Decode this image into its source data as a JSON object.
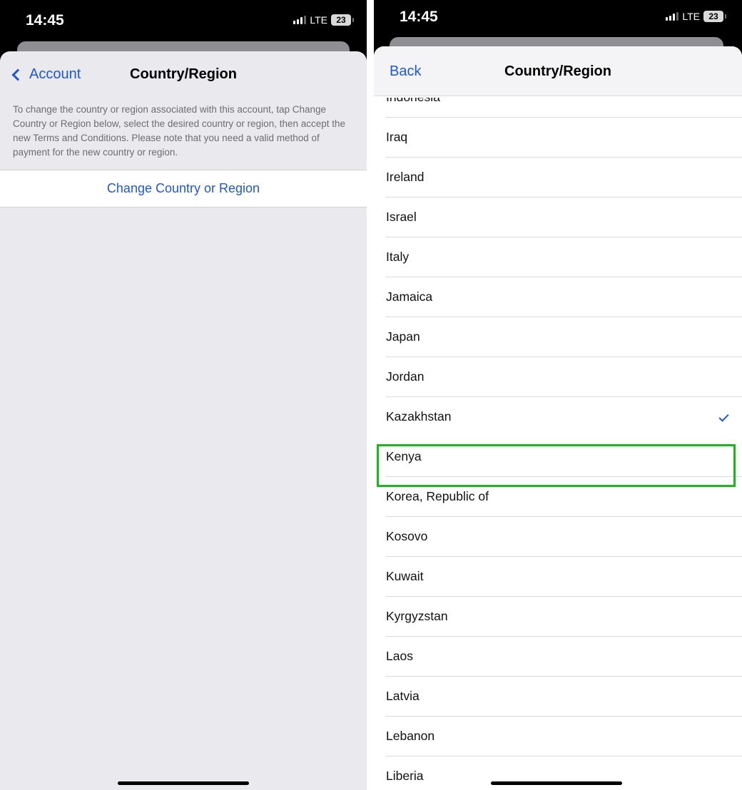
{
  "left": {
    "status": {
      "time": "14:45",
      "network": "LTE",
      "battery": "23"
    },
    "nav": {
      "back_label": "Account",
      "title": "Country/Region"
    },
    "explainer": "To change the country or region associated with this account, tap Change Country or Region below, select the desired country or region, then accept the new Terms and Conditions. Please note that you need a valid method of payment for the new country or region.",
    "change_button": "Change Country or Region"
  },
  "right": {
    "status": {
      "time": "14:45",
      "network": "LTE",
      "battery": "23"
    },
    "nav": {
      "back_label": "Back",
      "title": "Country/Region"
    },
    "countries": [
      "Indonesia",
      "Iraq",
      "Ireland",
      "Israel",
      "Italy",
      "Jamaica",
      "Japan",
      "Jordan",
      "Kazakhstan",
      "Kenya",
      "Korea, Republic of",
      "Kosovo",
      "Kuwait",
      "Kyrgyzstan",
      "Laos",
      "Latvia",
      "Lebanon",
      "Liberia"
    ],
    "selected_country": "Kazakhstan"
  },
  "colors": {
    "accent": "#1f57d8",
    "highlight": "#1cb51c"
  },
  "icons": {
    "back": "chevron-left-icon",
    "selection": "checkmark-icon",
    "signal": "signal-icon",
    "battery": "battery-icon"
  }
}
